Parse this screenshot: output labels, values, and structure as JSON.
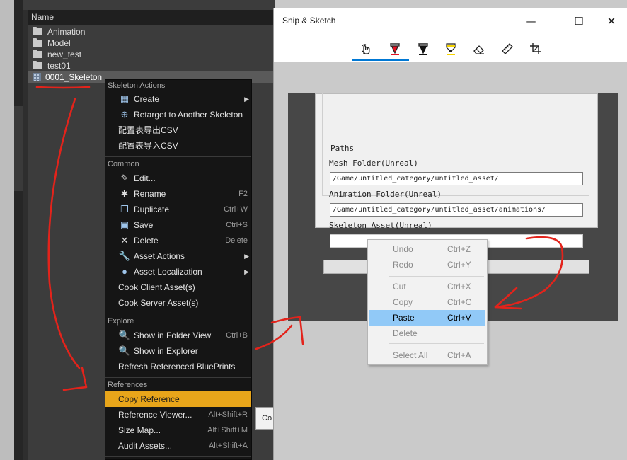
{
  "content_browser": {
    "header": "Name",
    "rows": [
      {
        "label": "Animation",
        "kind": "folder"
      },
      {
        "label": "Model",
        "kind": "folder"
      },
      {
        "label": "new_test",
        "kind": "folder"
      },
      {
        "label": "test01",
        "kind": "folder"
      },
      {
        "label": "0001_Skeleton",
        "kind": "skeleton"
      }
    ]
  },
  "context_menu": {
    "sections": {
      "skeleton_actions": "Skeleton Actions",
      "common": "Common",
      "explore": "Explore",
      "references": "References"
    },
    "items": [
      {
        "label": "Create",
        "shortcut": "",
        "submenu": true
      },
      {
        "label": "Retarget to Another Skeleton",
        "shortcut": ""
      },
      {
        "label": "配置表导出CSV",
        "shortcut": ""
      },
      {
        "label": "配置表导入CSV",
        "shortcut": ""
      },
      {
        "label": "Edit...",
        "shortcut": ""
      },
      {
        "label": "Rename",
        "shortcut": "F2"
      },
      {
        "label": "Duplicate",
        "shortcut": "Ctrl+W"
      },
      {
        "label": "Save",
        "shortcut": "Ctrl+S"
      },
      {
        "label": "Delete",
        "shortcut": "Delete"
      },
      {
        "label": "Asset Actions",
        "shortcut": "",
        "submenu": true
      },
      {
        "label": "Asset Localization",
        "shortcut": "",
        "submenu": true
      },
      {
        "label": "Cook Client Asset(s)",
        "shortcut": ""
      },
      {
        "label": "Cook Server Asset(s)",
        "shortcut": ""
      },
      {
        "label": "Show in Folder View",
        "shortcut": "Ctrl+B"
      },
      {
        "label": "Show in Explorer",
        "shortcut": ""
      },
      {
        "label": "Refresh Referenced BluePrints",
        "shortcut": ""
      },
      {
        "label": "Copy Reference",
        "shortcut": ""
      },
      {
        "label": "Reference Viewer...",
        "shortcut": "Alt+Shift+R"
      },
      {
        "label": "Size Map...",
        "shortcut": "Alt+Shift+M"
      },
      {
        "label": "Audit Assets...",
        "shortcut": "Alt+Shift+A"
      }
    ],
    "tooltip_fragment": "Co"
  },
  "snip": {
    "title": "Snip & Sketch",
    "window_buttons": {
      "minimize": "—",
      "maximize": "☐",
      "close": "✕"
    },
    "colors": {
      "accent": "#0078d4",
      "red_pen": "#e81123",
      "yellow_highlighter": "#f4d300"
    }
  },
  "dialog": {
    "group_title": "Paths",
    "mesh_label": "Mesh Folder(Unreal)",
    "mesh_value": "/Game/untitled_category/untitled_asset/",
    "anim_label": "Animation Folder(Unreal)",
    "anim_value": "/Game/untitled_category/untitled_asset/animations/",
    "skeleton_label": "Skeleton Asset(Unreal)",
    "skeleton_value": ""
  },
  "edit_menu": {
    "items": [
      {
        "label": "Undo",
        "shortcut": "Ctrl+Z"
      },
      {
        "label": "Redo",
        "shortcut": "Ctrl+Y"
      },
      {
        "label": "Cut",
        "shortcut": "Ctrl+X"
      },
      {
        "label": "Copy",
        "shortcut": "Ctrl+C"
      },
      {
        "label": "Paste",
        "shortcut": "Ctrl+V"
      },
      {
        "label": "Delete",
        "shortcut": ""
      },
      {
        "label": "Select All",
        "shortcut": "Ctrl+A"
      }
    ]
  },
  "theme": {
    "menu_highlight": "#e8a51a",
    "annotation": "#e3231b",
    "paste_highlight": "#91c9f7"
  }
}
